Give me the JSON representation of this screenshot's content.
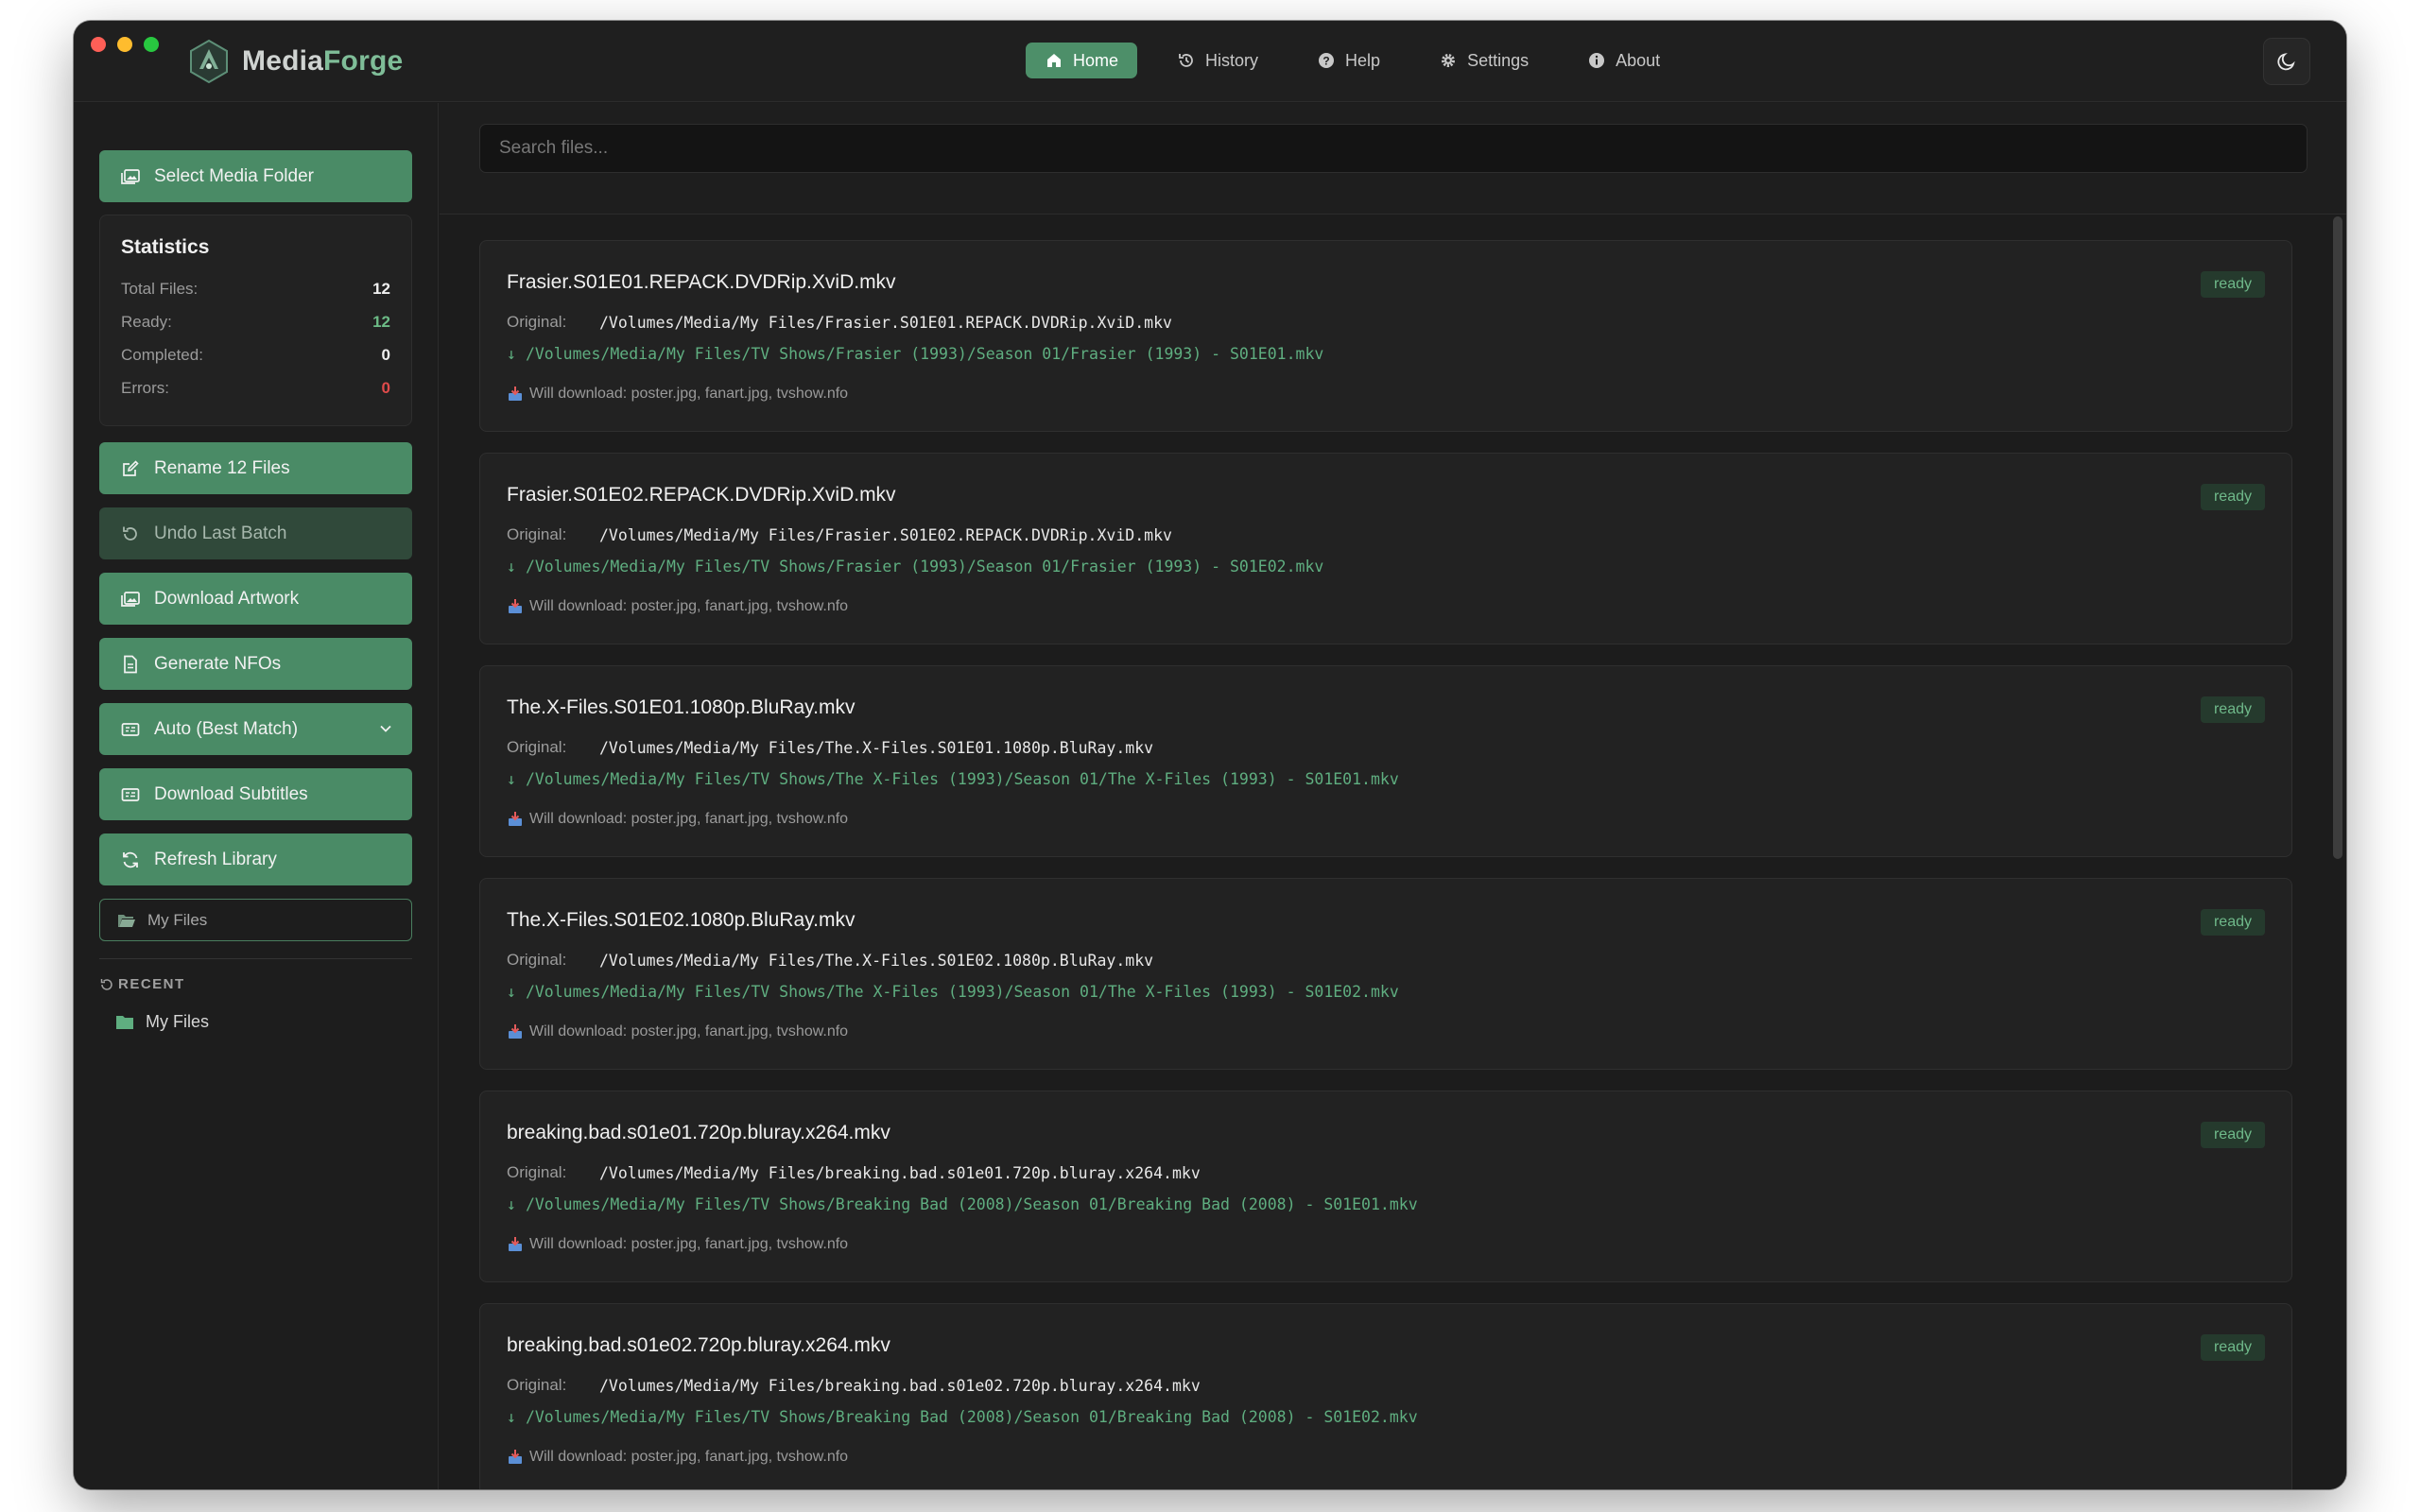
{
  "app": {
    "name_part1": "Media",
    "name_part2": "Forge"
  },
  "nav": {
    "items": [
      {
        "label": "Home",
        "icon": "home-icon",
        "active": true
      },
      {
        "label": "History",
        "icon": "history-icon",
        "active": false
      },
      {
        "label": "Help",
        "icon": "help-icon",
        "active": false
      },
      {
        "label": "Settings",
        "icon": "gear-icon",
        "active": false
      },
      {
        "label": "About",
        "icon": "info-icon",
        "active": false
      }
    ]
  },
  "sidebar": {
    "select_folder": "Select Media Folder",
    "stats": {
      "title": "Statistics",
      "total_label": "Total Files:",
      "total": "12",
      "ready_label": "Ready:",
      "ready": "12",
      "completed_label": "Completed:",
      "completed": "0",
      "errors_label": "Errors:",
      "errors": "0"
    },
    "rename": "Rename 12 Files",
    "undo": "Undo Last Batch",
    "artwork": "Download Artwork",
    "nfo": "Generate NFOs",
    "match_mode": "Auto (Best Match)",
    "subtitles": "Download Subtitles",
    "refresh": "Refresh Library",
    "current_folder": "My Files",
    "recent_title": "RECENT",
    "recent_items": [
      "My Files"
    ]
  },
  "search": {
    "placeholder": "Search files..."
  },
  "files": [
    {
      "name": "Frasier.S01E01.REPACK.DVDRip.XviD.mkv",
      "status": "ready",
      "original_label": "Original:",
      "original": "/Volumes/Media/My Files/Frasier.S01E01.REPACK.DVDRip.XviD.mkv",
      "arrow": "↓",
      "destination": "/Volumes/Media/My Files/TV Shows/Frasier (1993)/Season 01/Frasier (1993) - S01E01.mkv",
      "downloads": "Will download: poster.jpg, fanart.jpg, tvshow.nfo"
    },
    {
      "name": "Frasier.S01E02.REPACK.DVDRip.XviD.mkv",
      "status": "ready",
      "original_label": "Original:",
      "original": "/Volumes/Media/My Files/Frasier.S01E02.REPACK.DVDRip.XviD.mkv",
      "arrow": "↓",
      "destination": "/Volumes/Media/My Files/TV Shows/Frasier (1993)/Season 01/Frasier (1993) - S01E02.mkv",
      "downloads": "Will download: poster.jpg, fanart.jpg, tvshow.nfo"
    },
    {
      "name": "The.X-Files.S01E01.1080p.BluRay.mkv",
      "status": "ready",
      "original_label": "Original:",
      "original": "/Volumes/Media/My Files/The.X-Files.S01E01.1080p.BluRay.mkv",
      "arrow": "↓",
      "destination": "/Volumes/Media/My Files/TV Shows/The X-Files (1993)/Season 01/The X-Files (1993) - S01E01.mkv",
      "downloads": "Will download: poster.jpg, fanart.jpg, tvshow.nfo"
    },
    {
      "name": "The.X-Files.S01E02.1080p.BluRay.mkv",
      "status": "ready",
      "original_label": "Original:",
      "original": "/Volumes/Media/My Files/The.X-Files.S01E02.1080p.BluRay.mkv",
      "arrow": "↓",
      "destination": "/Volumes/Media/My Files/TV Shows/The X-Files (1993)/Season 01/The X-Files (1993) - S01E02.mkv",
      "downloads": "Will download: poster.jpg, fanart.jpg, tvshow.nfo"
    },
    {
      "name": "breaking.bad.s01e01.720p.bluray.x264.mkv",
      "status": "ready",
      "original_label": "Original:",
      "original": "/Volumes/Media/My Files/breaking.bad.s01e01.720p.bluray.x264.mkv",
      "arrow": "↓",
      "destination": "/Volumes/Media/My Files/TV Shows/Breaking Bad (2008)/Season 01/Breaking Bad (2008) - S01E01.mkv",
      "downloads": "Will download: poster.jpg, fanart.jpg, tvshow.nfo"
    },
    {
      "name": "breaking.bad.s01e02.720p.bluray.x264.mkv",
      "status": "ready",
      "original_label": "Original:",
      "original": "/Volumes/Media/My Files/breaking.bad.s01e02.720p.bluray.x264.mkv",
      "arrow": "↓",
      "destination": "/Volumes/Media/My Files/TV Shows/Breaking Bad (2008)/Season 01/Breaking Bad (2008) - S01E02.mkv",
      "downloads": "Will download: poster.jpg, fanart.jpg, tvshow.nfo"
    }
  ],
  "colors": {
    "accent": "#4a8b66",
    "ready_text": "#6fb98a",
    "error_text": "#e04b4b",
    "destination_text": "#5fae80"
  }
}
